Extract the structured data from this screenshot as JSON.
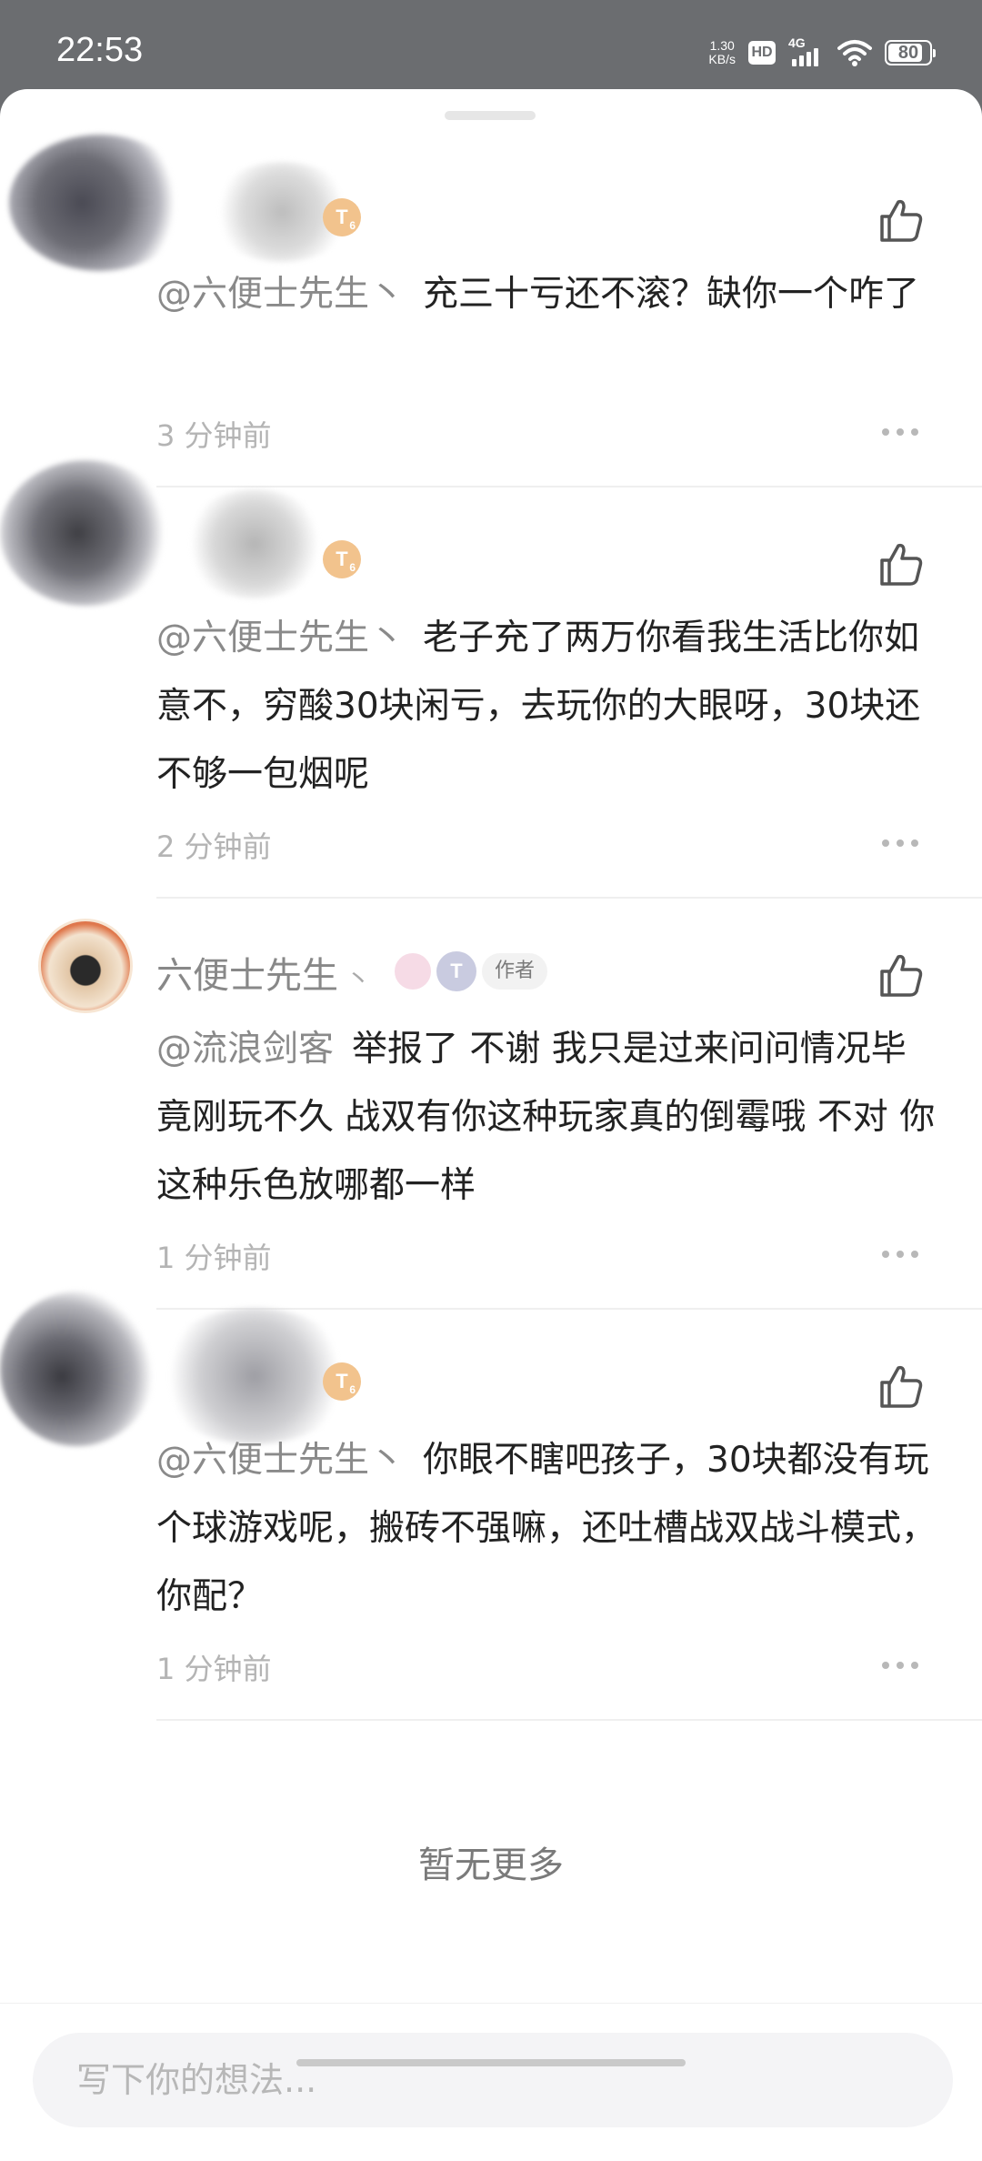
{
  "status_bar": {
    "time": "22:53",
    "net_speed_value": "1.30",
    "net_speed_unit": "KB/s",
    "hd_label": "HD",
    "network_type": "4G",
    "battery_level": "80"
  },
  "comments": [
    {
      "mention": "@六便士先生丶",
      "text": "充三十亏还不滚？缺你一个咋了",
      "time": "3 分钟前"
    },
    {
      "mention": "@六便士先生丶",
      "text": "老子充了两万你看我生活比你如意不，穷酸30块闲亏，去玩你的大眼呀，30块还不够一包烟呢",
      "time": "2 分钟前"
    },
    {
      "author_name": "六便士先生",
      "author_tag": "作者",
      "mention": "@流浪剑客",
      "text": "举报了  不谢   我只是过来问问情况毕竟刚玩不久   战双有你这种玩家真的倒霉哦   不对  你这种乐色放哪都一样",
      "time": "1 分钟前"
    },
    {
      "mention": "@六便士先生丶",
      "text": "你眼不瞎吧孩子，30块都没有玩个球游戏呢，搬砖不强嘛，还吐槽战双战斗模式，你配？",
      "time": "1 分钟前"
    }
  ],
  "no_more_label": "暂无更多",
  "composer": {
    "placeholder": "写下你的想法..."
  },
  "icons": {
    "like": "thumbs-up-icon",
    "more": "more-dots-icon"
  },
  "colors": {
    "status_bar_bg": "#6b6d70",
    "mention": "#8a8a8a",
    "timestamp": "#b4b4b4",
    "level_badge": "#f2c38d"
  }
}
